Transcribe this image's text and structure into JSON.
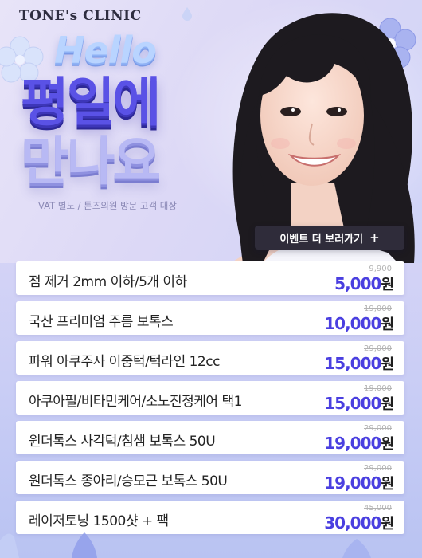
{
  "brand": {
    "logo_text": "TONE's CLINIC"
  },
  "hero": {
    "hello_text": "Hello",
    "title_line1": "평일에",
    "title_line2": "만나요",
    "subtitle": "VAT 별도 / 톤즈의원 방문 고객 대상",
    "event_button_label": "이벤트 더 보러가기",
    "event_button_icon": "+"
  },
  "colors": {
    "accent": "#4a3fe0",
    "title_primary": "#5a52e6",
    "button_bg": "#2f2c3a"
  },
  "currency_suffix": "원",
  "prices": [
    {
      "name": "점 제거 2mm 이하/5개 이하",
      "original": "9,900",
      "sale": "5,000"
    },
    {
      "name": "국산 프리미엄 주름 보톡스",
      "original": "19,000",
      "sale": "10,000"
    },
    {
      "name": "파워 아쿠주사 이중턱/턱라인 12cc",
      "original": "29,000",
      "sale": "15,000"
    },
    {
      "name": "아쿠아필/비타민케어/소노진정케어 택1",
      "original": "19,000",
      "sale": "15,000"
    },
    {
      "name": "원더톡스 사각턱/침샘 보톡스 50U",
      "original": "29,000",
      "sale": "19,000"
    },
    {
      "name": "원더톡스 종아리/승모근 보톡스 50U",
      "original": "29,000",
      "sale": "19,000"
    },
    {
      "name": "레이저토닝 1500샷 + 팩",
      "original": "45,000",
      "sale": "30,000"
    }
  ]
}
